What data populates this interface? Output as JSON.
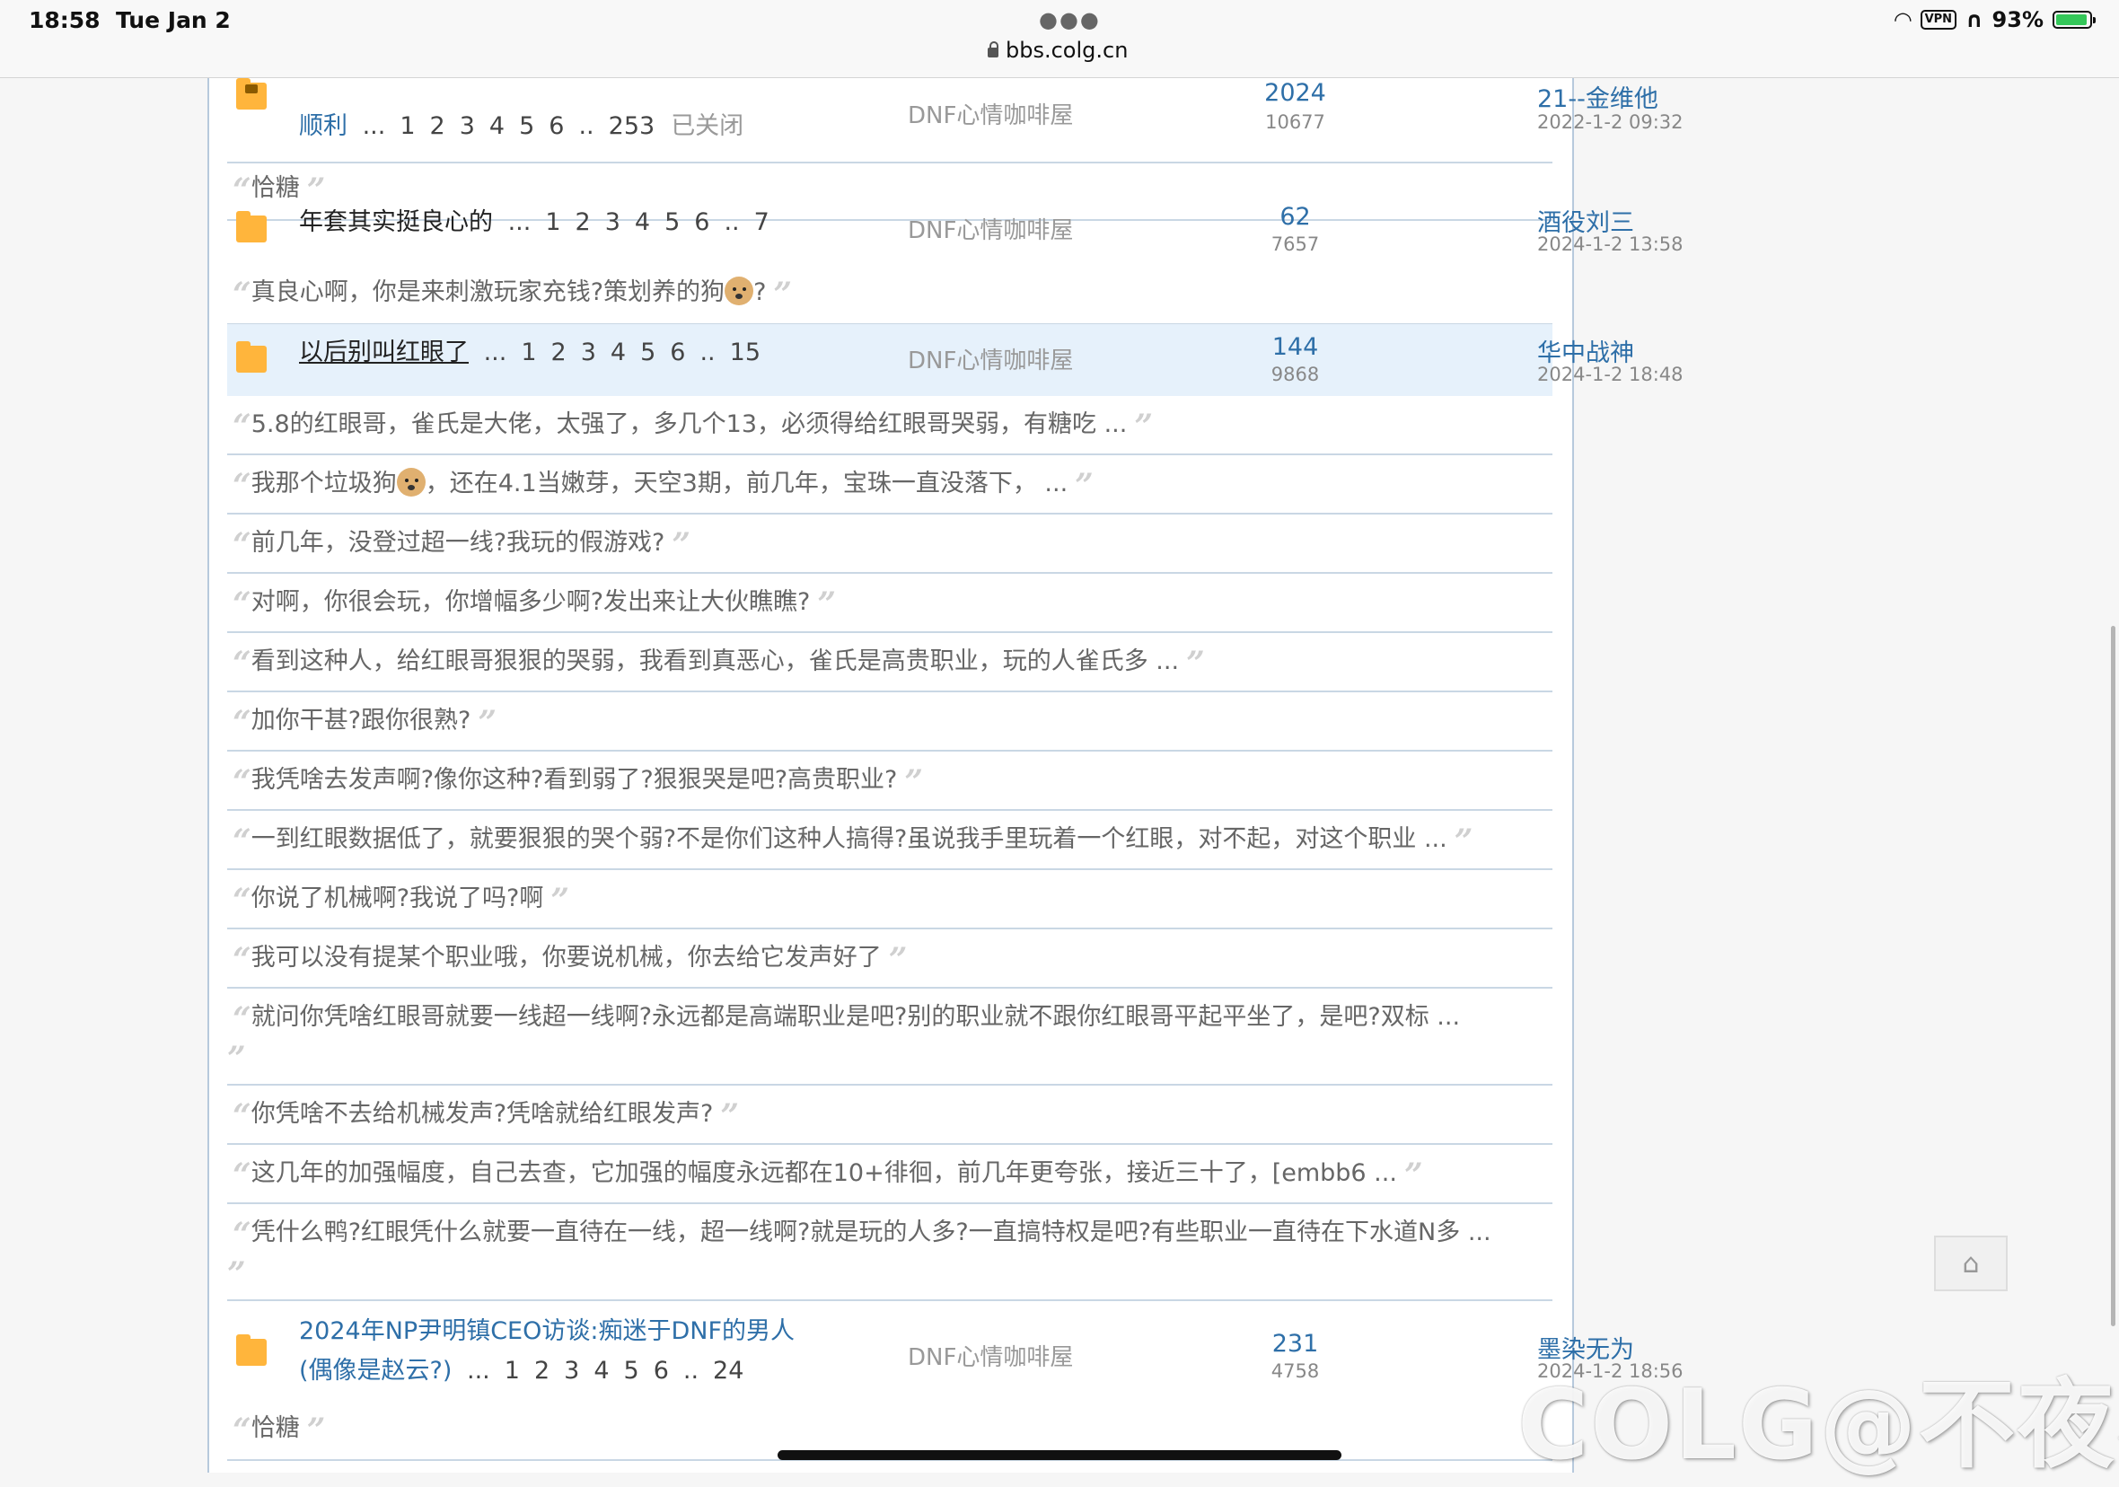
{
  "status_bar": {
    "time": "18:58",
    "date": "Tue Jan 2",
    "url": "bbs.colg.cn",
    "vpn": "VPN",
    "battery": "93%",
    "battery_level": 0.93
  },
  "threads": [
    {
      "title": "顺利",
      "pages": [
        "1",
        "2",
        "3",
        "4",
        "5",
        "6",
        "..",
        "253"
      ],
      "closed": "已关闭",
      "forum": "DNF心情咖啡屋",
      "replies": "2024",
      "views": "10677",
      "last_user": "21--金维他",
      "last_date": "2022-1-2 09:32",
      "locked": true,
      "replies_preview": [
        "恰糖"
      ]
    },
    {
      "title": "年套其实挺良心的",
      "pages": [
        "1",
        "2",
        "3",
        "4",
        "5",
        "6",
        "..",
        "7"
      ],
      "forum": "DNF心情咖啡屋",
      "replies": "62",
      "views": "7657",
      "last_user": "酒役刘三",
      "last_date": "2024-1-2 13:58",
      "replies_preview": [
        "真良心啊，你是来刺激玩家充钱?策划养的狗",
        "?"
      ]
    },
    {
      "title": "以后别叫红眼了",
      "pages": [
        "1",
        "2",
        "3",
        "4",
        "5",
        "6",
        "..",
        "15"
      ],
      "forum": "DNF心情咖啡屋",
      "replies": "144",
      "views": "9868",
      "last_user": "华中战神",
      "last_date": "2024-1-2 18:48",
      "highlighted": true,
      "replies_preview": [
        "5.8的红眼哥，雀氏是大佬，太强了，多几个13，必须得给红眼哥哭弱，有糖吃 ...",
        "我那个垃圾狗",
        "，还在4.1当嫩芽，天空3期，前几年，宝珠一直没落下，  ...",
        "前几年，没登过超一线?我玩的假游戏?",
        "对啊，你很会玩，你增幅多少啊?发出来让大伙瞧瞧?",
        "看到这种人，给红眼哥狠狠的哭弱，我看到真恶心，雀氏是高贵职业，玩的人雀氏多 ...",
        "加你干甚?跟你很熟?",
        "我凭啥去发声啊?像你这种?看到弱了?狠狠哭是吧?高贵职业?",
        "一到红眼数据低了，就要狠狠的哭个弱?不是你们这种人搞得?虽说我手里玩着一个红眼，对不起，对这个职业 ...",
        "你说了机械啊?我说了吗?啊",
        "我可以没有提某个职业哦，你要说机械，你去给它发声好了",
        "就问你凭啥红眼哥就要一线超一线啊?永远都是高端职业是吧?别的职业就不跟你红眼哥平起平坐了，是吧?双标 ...",
        "你凭啥不去给机械发声?凭啥就给红眼发声?",
        "这几年的加强幅度，自己去查，它加强的幅度永远都在10+徘徊，前几年更夸张，接近三十了，[embb6 ...",
        "凭什么鸭?红眼凭什么就要一直待在一线，超一线啊?就是玩的人多?一直搞特权是吧?有些职业一直待在下水道N多 ..."
      ]
    },
    {
      "title_line1": "2024年NP尹明镇CEO访谈:痴迷于DNF的男人",
      "title_line2": "(偶像是赵云?)",
      "pages": [
        "1",
        "2",
        "3",
        "4",
        "5",
        "6",
        "..",
        "24"
      ],
      "forum": "DNF心情咖啡屋",
      "replies": "231",
      "views": "4758",
      "last_user": "墨染无为",
      "last_date": "2024-1-2 18:56",
      "replies_preview": [
        "恰糖"
      ]
    }
  ],
  "ellipsis": "...",
  "scroll_top_icon": "arrow-up-to-top-icon",
  "watermark": "COLG@不夜星"
}
